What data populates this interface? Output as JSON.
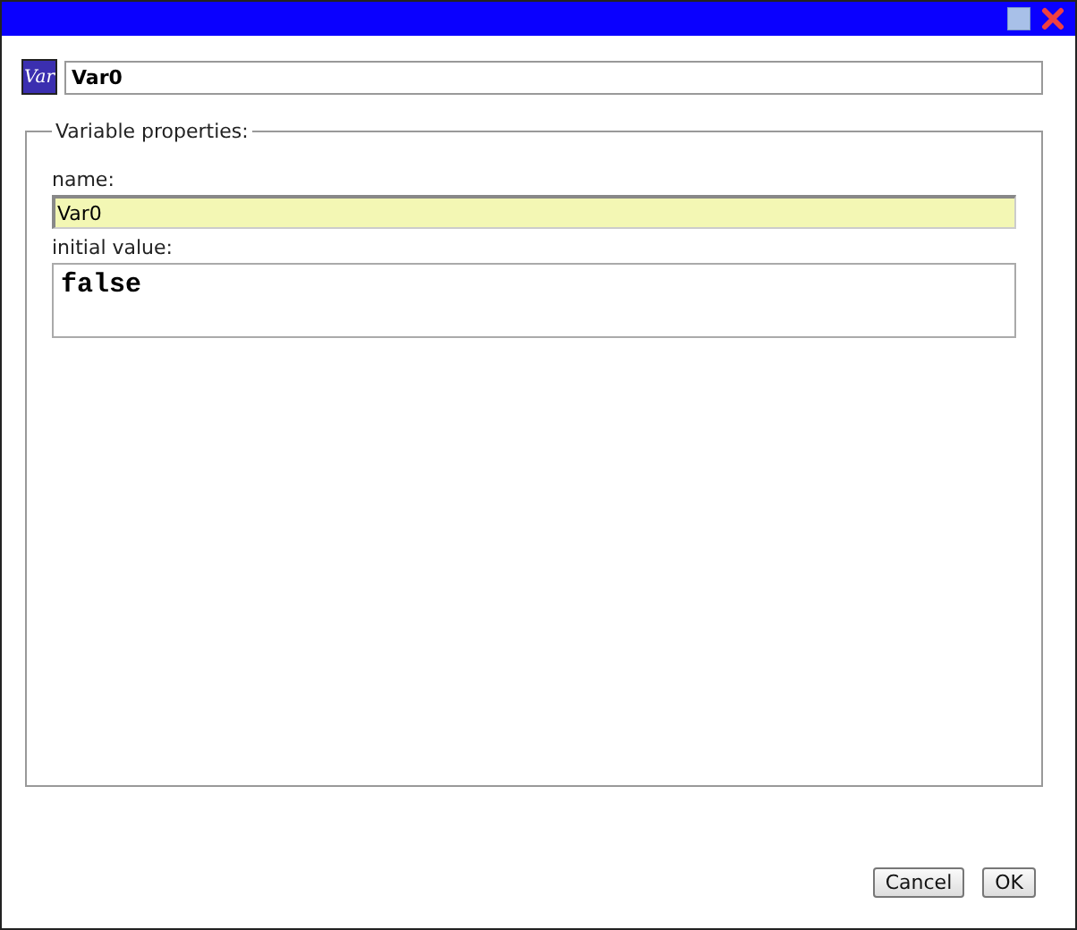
{
  "header": {
    "icon_label": "Var",
    "title_value": "Var0"
  },
  "properties": {
    "legend": "Variable properties:",
    "name_label": "name:",
    "name_value": "Var0",
    "initial_label": "initial value:",
    "initial_value": "false"
  },
  "buttons": [
    "Cancel",
    "OK"
  ]
}
